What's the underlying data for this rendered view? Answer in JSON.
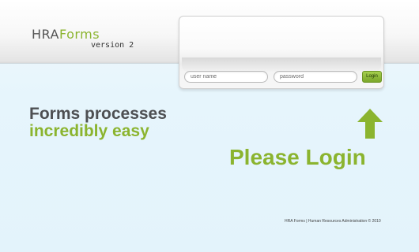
{
  "header": {
    "logo_part1": "HRA",
    "logo_part2": "Forms",
    "version": "version 2"
  },
  "login": {
    "username_placeholder": "user name",
    "password_placeholder": "password",
    "button_label": "Login"
  },
  "main": {
    "tagline_line1": "Forms processes",
    "tagline_line2": "incredibly easy",
    "please_login": "Please Login",
    "arrow_icon": "arrow-up-icon"
  },
  "footer": {
    "text": "HRA Forms | Human Resources Administration © 2010"
  },
  "colors": {
    "accent_green": "#8bb42f",
    "dark_gray": "#4d4f52",
    "background": "#e3f3fb"
  }
}
